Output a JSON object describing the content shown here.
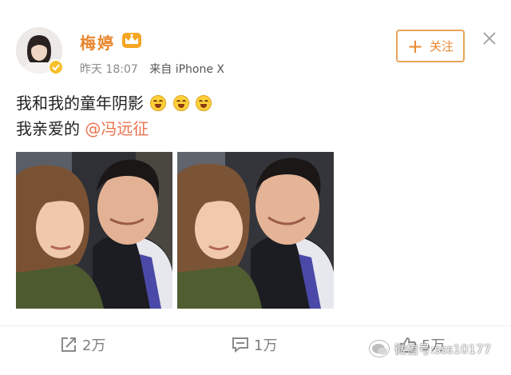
{
  "user": {
    "name": "梅婷",
    "time": "昨天 18:07",
    "source": "来自 iPhone X"
  },
  "follow_button": {
    "label": "关注"
  },
  "post": {
    "line1": "我和我的童年阴影",
    "line2_prefix": "我亲爱的 ",
    "mention": "@冯远征"
  },
  "images": [
    {
      "name": "selfie-photo-1"
    },
    {
      "name": "selfie-photo-2"
    }
  ],
  "actions": {
    "share_count": "2万",
    "comment_count": "1万",
    "like_count": "5万"
  },
  "watermark": {
    "text": "微信号:sss10177"
  },
  "colors": {
    "brand_orange": "#e8872f",
    "mention": "#eb7350",
    "muted": "#8a8a8a"
  }
}
